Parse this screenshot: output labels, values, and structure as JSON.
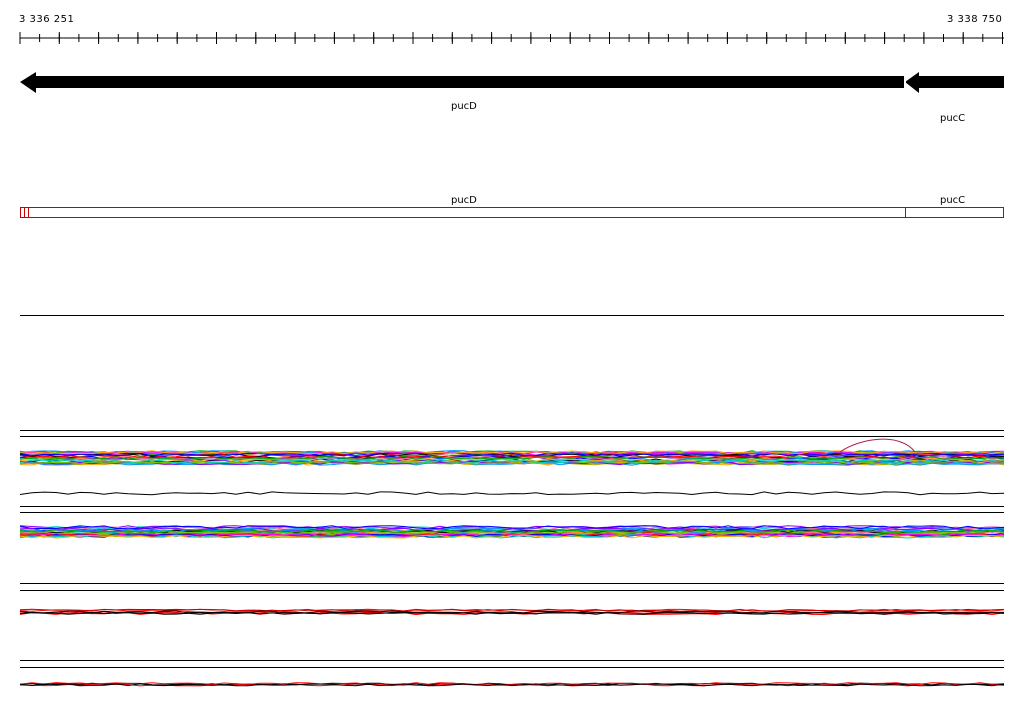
{
  "ruler": {
    "start_label": "3 336 251",
    "end_label": "3 338 750"
  },
  "genes": [
    {
      "name": "pucD",
      "strand": "-"
    },
    {
      "name": "pucC",
      "strand": "-"
    }
  ],
  "annotation_track": {
    "labels": [
      "pucD",
      "pucC"
    ],
    "color": "#cc0000"
  },
  "colors": {
    "gene_fill": "#000000",
    "annotation_stroke": "#cc0000",
    "track_border": "#000000"
  }
}
